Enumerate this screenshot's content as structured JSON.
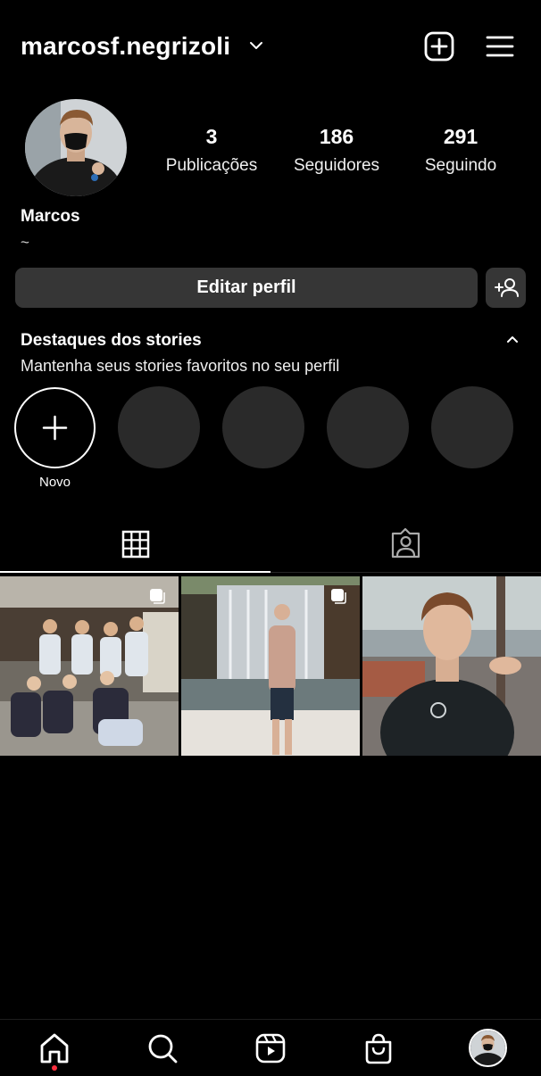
{
  "header": {
    "username": "marcosf.negrizoli",
    "icons": {
      "switch_account": "chevron-down-icon",
      "new_post": "plus-square-icon",
      "menu": "hamburger-menu-icon"
    }
  },
  "profile": {
    "stats": {
      "posts": {
        "value": "3",
        "label": "Publicações"
      },
      "followers": {
        "value": "186",
        "label": "Seguidores"
      },
      "following": {
        "value": "291",
        "label": "Seguindo"
      }
    },
    "display_name": "Marcos",
    "bio": "~"
  },
  "actions": {
    "edit_profile_label": "Editar perfil",
    "discover_people_icon": "add-person-icon"
  },
  "highlights": {
    "title": "Destaques dos stories",
    "subtitle": "Mantenha seus stories favoritos no seu perfil",
    "new_label": "Novo",
    "placeholder_count": 4
  },
  "tabs": [
    {
      "name": "posts-grid",
      "icon": "grid-icon",
      "active": true
    },
    {
      "name": "tagged",
      "icon": "tagged-person-icon",
      "active": false
    }
  ],
  "posts": [
    {
      "description": "group-photo",
      "multiple": true
    },
    {
      "description": "waterfall-photo",
      "multiple": true
    },
    {
      "description": "selfie-photo",
      "multiple": false
    }
  ],
  "bottom_nav": [
    {
      "name": "home",
      "icon": "home-icon",
      "active": true,
      "notification_dot": true
    },
    {
      "name": "search",
      "icon": "search-icon"
    },
    {
      "name": "reels",
      "icon": "reels-icon"
    },
    {
      "name": "shop",
      "icon": "shopping-bag-icon"
    },
    {
      "name": "profile",
      "icon": "profile-avatar"
    }
  ],
  "colors": {
    "background": "#000000",
    "button": "#363636",
    "text": "#ffffff",
    "highlight_placeholder": "#2a2a2a",
    "notification": "#ff3040"
  }
}
